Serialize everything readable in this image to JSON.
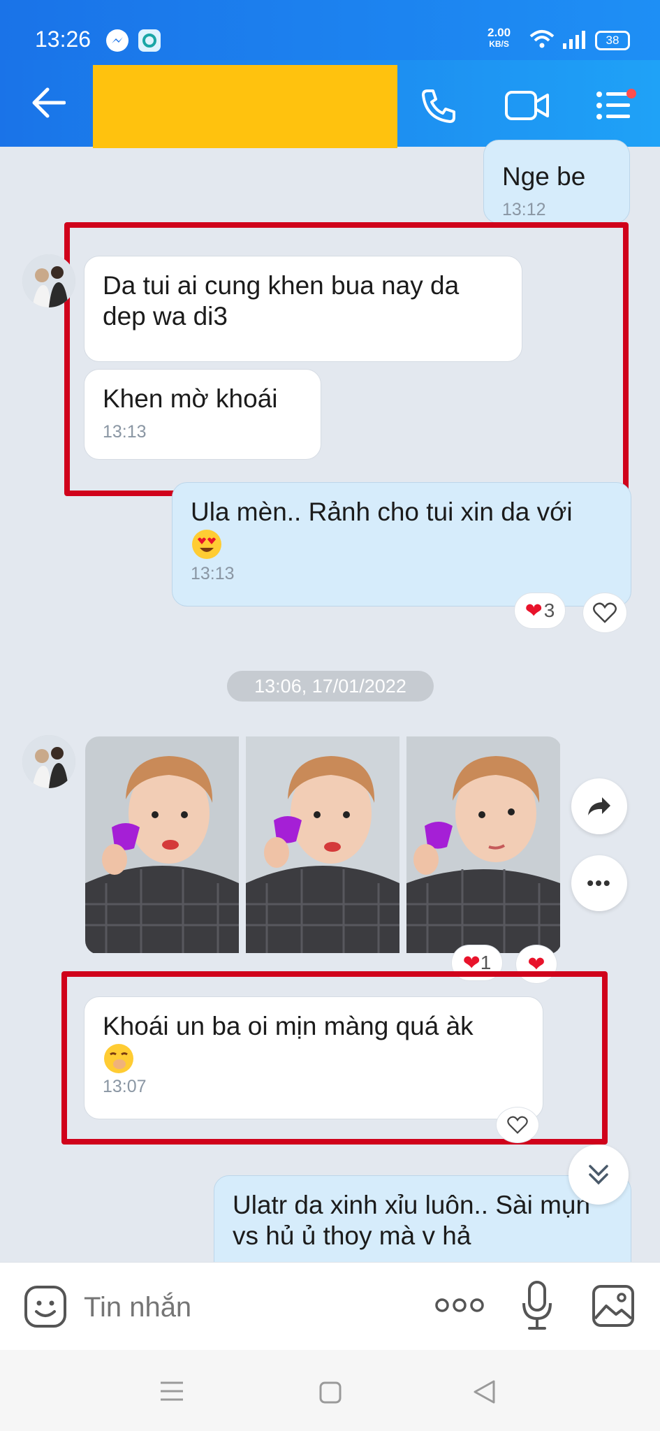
{
  "status_bar": {
    "time": "13:26",
    "net_speed_value": "2.00",
    "net_speed_unit": "KB/S",
    "battery": "38"
  },
  "header": {
    "icons": [
      "back-arrow-icon",
      "phone-icon",
      "video-icon",
      "menu-icon"
    ]
  },
  "messages": [
    {
      "text": "Nge be",
      "time": "13:12"
    },
    {
      "text": "Da tui ai cung khen bua nay da dep wa di3"
    },
    {
      "text": "Khen mờ khoái",
      "time": "13:13"
    },
    {
      "text": "Ula mèn.. Rảnh cho tui xin da với",
      "time": "13:13",
      "reaction_count": "3"
    },
    {
      "date": "13:06, 17/01/2022"
    },
    {
      "reaction_count": "1"
    },
    {
      "text": "Khoái un ba oi mịn màng quá àk",
      "time": "13:07"
    },
    {
      "text": "Ulatr da xinh xỉu luôn.. Sài mụn vs hủ ủ thoy mà v hả"
    }
  ],
  "input": {
    "placeholder": "Tin nhắn"
  },
  "colors": {
    "header_blue": "#1a73e8",
    "highlight_red": "#d0021b",
    "redaction_yellow": "#ffc20e",
    "outgoing_bubble": "#d6ecfb"
  }
}
